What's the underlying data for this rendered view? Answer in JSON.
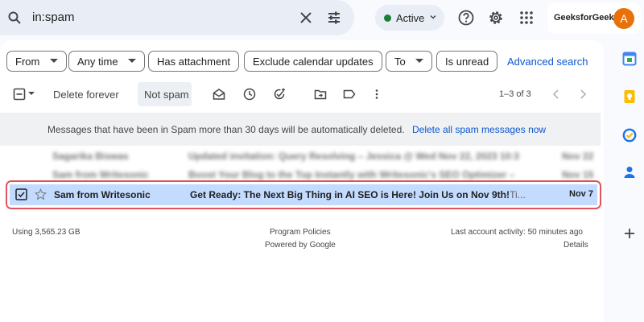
{
  "search": {
    "query": "in:spam"
  },
  "status": {
    "label": "Active",
    "dot_color": "#188038"
  },
  "account": {
    "brand": "GeeksforGeeks",
    "avatar_letter": "A",
    "avatar_color": "#e8710a"
  },
  "filters": {
    "chips": [
      "From",
      "Any time",
      "Has attachment",
      "Exclude calendar updates",
      "To",
      "Is unread"
    ],
    "advanced_link": "Advanced search"
  },
  "toolbar": {
    "delete_forever": "Delete forever",
    "not_spam": "Not spam",
    "pager": "1–3 of 3"
  },
  "banner": {
    "message": "Messages that have been in Spam more than 30 days will be automatically deleted.",
    "action": "Delete all spam messages now"
  },
  "emails": [
    {
      "sender": "Sagarika Biswas",
      "subject": "Updated invitation: Query Resolving – Jessica @ Wed Nov 22, 2023 10:3",
      "date": "Nov 22",
      "blurred": true
    },
    {
      "sender": "Sam from Writesonic",
      "subject": "Boost Your Blog to the Top Instantly with Writesonic's SEO Optimizer –",
      "date": "Nov 15",
      "blurred": true
    },
    {
      "sender": "Sam from Writesonic",
      "subject": "Get Ready: The Next Big Thing in AI SEO is Here! Join Us on Nov 9th!",
      "snippet": "- Ti...",
      "date": "Nov 7",
      "selected": true
    }
  ],
  "footer": {
    "storage": "Using 3,565.23 GB",
    "policies": "Program Policies",
    "powered": "Powered by Google",
    "activity": "Last account activity: 50 minutes ago",
    "details": "Details"
  },
  "rail": [
    "calendar-icon",
    "keep-icon",
    "tasks-icon",
    "contacts-icon",
    "add-icon"
  ]
}
